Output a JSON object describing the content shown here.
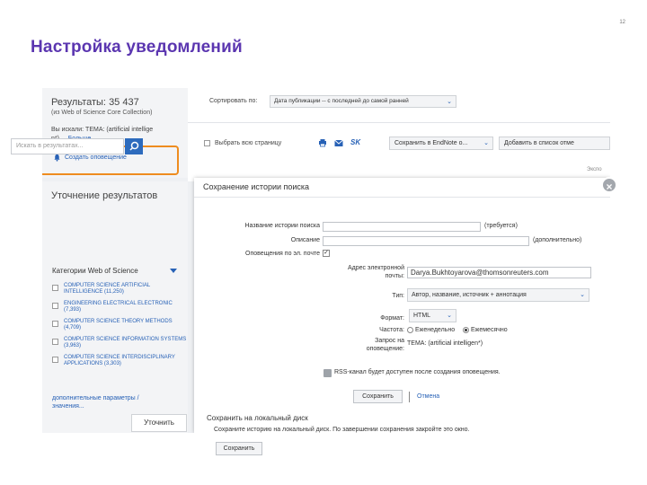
{
  "slide": {
    "number": "12",
    "title": "Настройка уведомлений"
  },
  "results": {
    "label": "Результаты:",
    "count": "35 437",
    "source": "(из Web of Science Core Collection)",
    "query_line1": "Вы искали: ТЕМА: (artificial intellige",
    "query_line2": "n*) ...",
    "more": "Больше",
    "create_alert": "Создать оповещение"
  },
  "refine": {
    "title": "Уточнение результатов",
    "search_placeholder": "Искать в результатах...",
    "category_header": "Категории Web of Science",
    "categories": [
      {
        "name": "COMPUTER SCIENCE ARTIFICIAL INTELLIGENCE",
        "count": "(11,250)"
      },
      {
        "name": "ENGINEERING ELECTRICAL ELECTRONIC",
        "count": "(7,393)"
      },
      {
        "name": "COMPUTER SCIENCE THEORY METHODS",
        "count": "(4,709)"
      },
      {
        "name": "COMPUTER SCIENCE INFORMATION SYSTEMS",
        "count": "(3,963)"
      },
      {
        "name": "COMPUTER SCIENCE INTERDISCIPLINARY APPLICATIONS",
        "count": "(3,303)"
      }
    ],
    "more_params": "дополнительные параметры / значения...",
    "refine_button": "Уточнить"
  },
  "toolbar": {
    "sort_label": "Сортировать по:",
    "sort_value": "Дата публикации -- с последней до самой ранней",
    "select_page": "Выбрать всю страницу",
    "sk_label": "SK",
    "save_endnote": "Сохранить в EndNote o...",
    "add_marked": "Добавить в список отме",
    "small_text": "Экспо"
  },
  "dialog": {
    "title": "Сохранение истории поиска",
    "close_label": "×",
    "history_name_label": "Название истории поиска",
    "history_name_value": "",
    "required_note": "(требуется)",
    "description_label": "Описание",
    "description_value": "",
    "optional_note": "(дополнительно)",
    "email_alerts_label": "Оповещения по эл. почте",
    "email_alerts_check": "✓",
    "email_label_1": "Адрес электронной",
    "email_label_2": "почты:",
    "email_value": "Darya.Bukhtoyarova@thomsonreuters.com",
    "type_label": "Тип:",
    "type_value": "Автор, название, источник + аннотация",
    "format_label": "Формат:",
    "format_value": "HTML",
    "frequency_label": "Частота:",
    "freq_weekly": "Еженедельно",
    "freq_monthly": "Ежемесячно",
    "alert_query_label_1": "Запрос на",
    "alert_query_label_2": "оповещение:",
    "alert_query_value": "ТЕМА: (artificial intelligen*)",
    "rss_text": "RSS-канал будет доступен после создания оповещения.",
    "save_button": "Сохранить",
    "cancel_link": "Отмена",
    "local_title": "Сохранить на локальный диск",
    "local_text": "Сохраните историю на локальный диск. По завершении сохранения закройте это окно.",
    "local_button": "Сохранить"
  },
  "colors": {
    "title": "#5b36b0",
    "link": "#2761b6",
    "highlight": "#ee8c1f"
  }
}
